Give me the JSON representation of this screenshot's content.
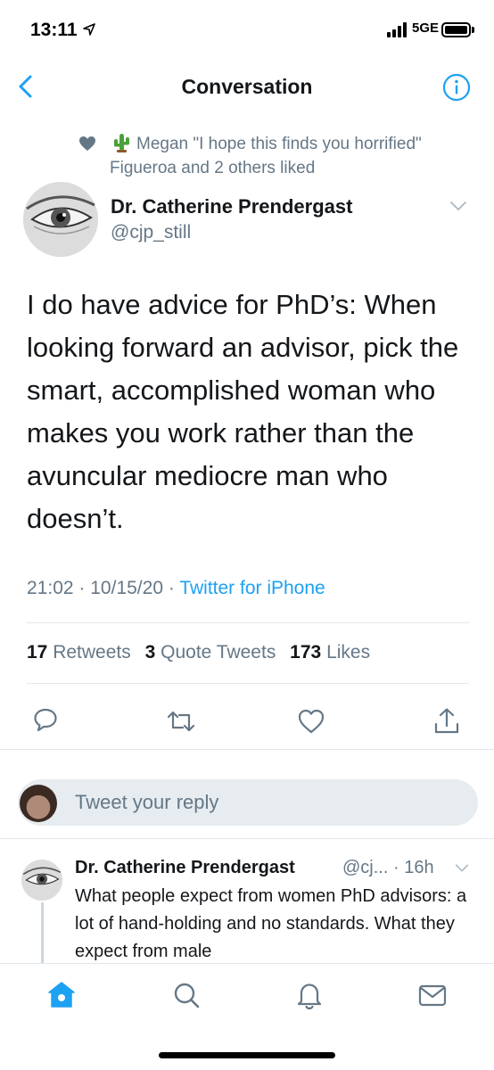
{
  "status_bar": {
    "time": "13:11",
    "network": "5GE"
  },
  "header": {
    "title": "Conversation"
  },
  "social_context": {
    "text": "Megan \"I hope this finds you horrified\" Figueroa and 2 others liked"
  },
  "tweet": {
    "author_name": "Dr. Catherine Prendergast",
    "author_handle": "@cjp_still",
    "text": "I do have advice for PhD’s: When looking forward an advisor, pick the smart, accomplished woman who makes you work rather than the avuncular mediocre man who doesn’t.",
    "time": "21:02",
    "date": "10/15/20",
    "client": "Twitter for iPhone",
    "separator": "·"
  },
  "stats": {
    "retweets_count": "17",
    "retweets_label": "Retweets",
    "quotes_count": "3",
    "quotes_label": "Quote Tweets",
    "likes_count": "173",
    "likes_label": "Likes"
  },
  "reply_box": {
    "placeholder": "Tweet your reply"
  },
  "reply": {
    "author_name": "Dr. Catherine Prendergast",
    "author_handle": "@cj...",
    "age": "· 16h",
    "text": "What people expect from women PhD advisors: a lot of hand-holding and no standards. What they expect from male"
  },
  "colors": {
    "accent": "#1da1f2",
    "secondary_text": "#657786",
    "primary_text": "#14171a",
    "divider": "#e1e8ed"
  },
  "icons": {
    "back": "chevron-left-icon",
    "info": "info-icon",
    "reply": "reply-icon",
    "retweet": "retweet-icon",
    "like": "heart-icon",
    "share": "share-icon",
    "home": "home-icon",
    "search": "search-icon",
    "notifications": "bell-icon",
    "messages": "mail-icon"
  }
}
